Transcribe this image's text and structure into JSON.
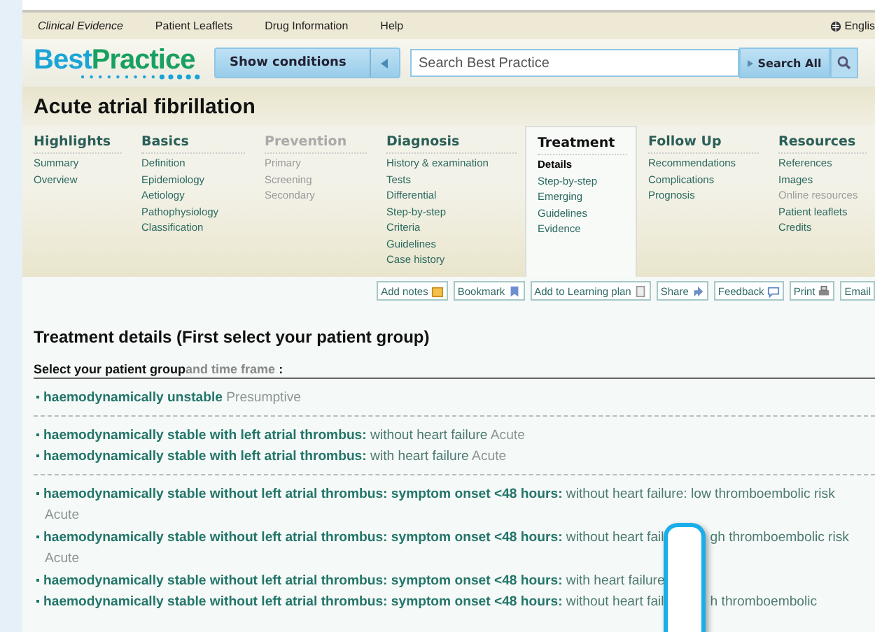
{
  "top_nav": [
    {
      "label": "Clinical Evidence",
      "italic": true
    },
    {
      "label": "Patient Leaflets",
      "italic": false
    },
    {
      "label": "Drug Information",
      "italic": false
    },
    {
      "label": "Help",
      "italic": false
    }
  ],
  "language": "Englis",
  "logo": {
    "part1": "Best",
    "part2": "Practice"
  },
  "show_conditions": "Show conditions",
  "search": {
    "placeholder": "Search Best Practice",
    "button": "Search All"
  },
  "page_title": "Acute atrial fibrillation",
  "tabs": [
    {
      "heading": "Highlights",
      "selected": false,
      "disabled": false,
      "items": [
        {
          "label": "Summary",
          "selected": false,
          "disabled": false
        },
        {
          "label": "Overview",
          "selected": false,
          "disabled": false
        }
      ]
    },
    {
      "heading": "Basics",
      "selected": false,
      "disabled": false,
      "items": [
        {
          "label": "Definition",
          "selected": false,
          "disabled": false
        },
        {
          "label": "Epidemiology",
          "selected": false,
          "disabled": false
        },
        {
          "label": "Aetiology",
          "selected": false,
          "disabled": false
        },
        {
          "label": "Pathophysiology",
          "selected": false,
          "disabled": false
        },
        {
          "label": "Classification",
          "selected": false,
          "disabled": false
        }
      ]
    },
    {
      "heading": "Prevention",
      "selected": false,
      "disabled": true,
      "items": [
        {
          "label": "Primary",
          "selected": false,
          "disabled": true
        },
        {
          "label": "Screening",
          "selected": false,
          "disabled": true
        },
        {
          "label": "Secondary",
          "selected": false,
          "disabled": true
        }
      ]
    },
    {
      "heading": "Diagnosis",
      "selected": false,
      "disabled": false,
      "items": [
        {
          "label": "History & examination",
          "selected": false,
          "disabled": false
        },
        {
          "label": "Tests",
          "selected": false,
          "disabled": false
        },
        {
          "label": "Differential",
          "selected": false,
          "disabled": false
        },
        {
          "label": "Step-by-step",
          "selected": false,
          "disabled": false
        },
        {
          "label": "Criteria",
          "selected": false,
          "disabled": false
        },
        {
          "label": "Guidelines",
          "selected": false,
          "disabled": false
        },
        {
          "label": "Case history",
          "selected": false,
          "disabled": false
        }
      ]
    },
    {
      "heading": "Treatment",
      "selected": true,
      "disabled": false,
      "items": [
        {
          "label": "Details",
          "selected": true,
          "disabled": false
        },
        {
          "label": "Step-by-step",
          "selected": false,
          "disabled": false
        },
        {
          "label": "Emerging",
          "selected": false,
          "disabled": false
        },
        {
          "label": "Guidelines",
          "selected": false,
          "disabled": false
        },
        {
          "label": "Evidence",
          "selected": false,
          "disabled": false
        }
      ]
    },
    {
      "heading": "Follow Up",
      "selected": false,
      "disabled": false,
      "items": [
        {
          "label": "Recommendations",
          "selected": false,
          "disabled": false
        },
        {
          "label": "Complications",
          "selected": false,
          "disabled": false
        },
        {
          "label": "Prognosis",
          "selected": false,
          "disabled": false
        }
      ]
    },
    {
      "heading": "Resources",
      "selected": false,
      "disabled": false,
      "items": [
        {
          "label": "References",
          "selected": false,
          "disabled": false
        },
        {
          "label": "Images",
          "selected": false,
          "disabled": false
        },
        {
          "label": "Online resources",
          "selected": false,
          "disabled": true
        },
        {
          "label": "Patient leaflets",
          "selected": false,
          "disabled": false
        },
        {
          "label": "Credits",
          "selected": false,
          "disabled": false
        }
      ]
    }
  ],
  "tools": [
    {
      "label": "Add notes",
      "kind": "note"
    },
    {
      "label": "Bookmark",
      "kind": "bookmark"
    },
    {
      "label": "Add to Learning plan",
      "kind": "page"
    },
    {
      "label": "Share",
      "kind": "share"
    },
    {
      "label": "Feedback",
      "kind": "speech"
    },
    {
      "label": "Print",
      "kind": "printer"
    },
    {
      "label": "Email",
      "kind": "plain"
    }
  ],
  "section_title": "Treatment details (First select your patient group)",
  "select_label": {
    "main": "Select your patient group",
    "sub": "and time frame",
    "colon": ":"
  },
  "groups": [
    [
      {
        "term": "haemodynamically unstable",
        "tag": "Presumptive"
      }
    ],
    [
      {
        "term": "haemodynamically stable with left atrial thrombus:",
        "detail": "without heart failure",
        "tag": "Acute"
      },
      {
        "term": "haemodynamically stable with left atrial thrombus:",
        "detail": "with heart failure",
        "tag": "Acute"
      }
    ],
    [
      {
        "term": "haemodynamically stable without left atrial thrombus: symptom onset <48 hours:",
        "detail": "without heart failure: low thromboembolic risk",
        "tag": "Acute"
      },
      {
        "term": "haemodynamically stable without left atrial thrombus: symptom onset <48 hours:",
        "detail": "without heart fail",
        "detail_after": "gh thromboembolic risk",
        "tag": "Acute"
      },
      {
        "term": "haemodynamically stable without left atrial thrombus: symptom onset <48 hours:",
        "detail": "with heart failure"
      },
      {
        "term": "haemodynamically stable without left atrial thrombus: symptom onset <48 hours:",
        "detail": "without heart fail",
        "detail_after": "h thromboembolic"
      }
    ]
  ]
}
